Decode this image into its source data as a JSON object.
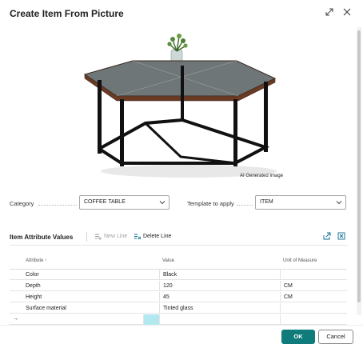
{
  "dialog": {
    "title": "Create Item From Picture"
  },
  "picture": {
    "caption": "AI Generated Image"
  },
  "fields": {
    "category_label": "Category",
    "category_value": "COFFEE TABLE",
    "template_label": "Template to apply",
    "template_value": "ITEM"
  },
  "attributes": {
    "section_title": "Item Attribute Values",
    "new_line_label": "New Line",
    "delete_line_label": "Delete Line",
    "columns": {
      "attribute": "Attribute ↑",
      "value": "Value",
      "unit": "Unit of Measure"
    },
    "rows": [
      {
        "attribute": "Color",
        "value": "Black",
        "unit": ""
      },
      {
        "attribute": "Depth",
        "value": "120",
        "unit": "CM"
      },
      {
        "attribute": "Height",
        "value": "45",
        "unit": "CM"
      },
      {
        "attribute": "Surface material",
        "value": "Tinted glass",
        "unit": ""
      }
    ],
    "new_row_marker": "→"
  },
  "footer": {
    "ok_label": "OK",
    "cancel_label": "Cancel"
  },
  "colors": {
    "primary": "#0f7b7b",
    "selected_cell": "#b2e9f0",
    "action_blue": "#0b6a8f"
  },
  "icons": [
    "expand-icon",
    "close-icon",
    "chevron-down-icon",
    "new-line-icon",
    "delete-line-icon",
    "share-icon",
    "excel-icon"
  ]
}
